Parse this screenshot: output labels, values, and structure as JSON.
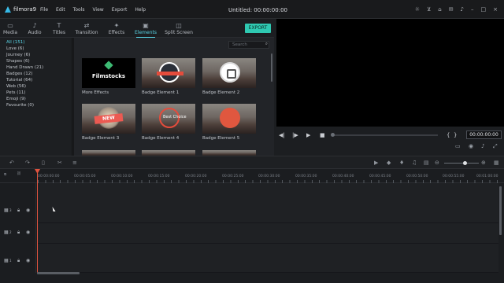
{
  "app": {
    "logo_text": "filmora9",
    "doc_title": "Untitled: 00:00:00:00"
  },
  "menu": [
    "File",
    "Edit",
    "Tools",
    "View",
    "Export",
    "Help"
  ],
  "tabs": [
    {
      "label": "Media",
      "icon": "folder-icon"
    },
    {
      "label": "Audio",
      "icon": "music-note-icon"
    },
    {
      "label": "Titles",
      "icon": "text-icon"
    },
    {
      "label": "Transition",
      "icon": "transition-icon"
    },
    {
      "label": "Effects",
      "icon": "effects-icon"
    },
    {
      "label": "Elements",
      "icon": "image-icon",
      "active": true
    },
    {
      "label": "Split Screen",
      "icon": "split-screen-icon"
    }
  ],
  "export_label": "EXPORT",
  "search": {
    "placeholder": "Search"
  },
  "categories": [
    "All (151)",
    "Love (6)",
    "Journey (6)",
    "Shapes (6)",
    "Hand Drawn (21)",
    "Badges (12)",
    "Tutorial (64)",
    "Web (56)",
    "Pets (11)",
    "Emoji (9)",
    "Favourite (0)"
  ],
  "items": [
    {
      "label": "More Effects",
      "brand": "Filmstocks"
    },
    {
      "label": "Badge Element 1"
    },
    {
      "label": "Badge Element 2"
    },
    {
      "label": "Badge Element 3",
      "badge_text": "NEW"
    },
    {
      "label": "Badge Element 4",
      "badge_text": "Best Choice"
    },
    {
      "label": "Badge Element 5"
    }
  ],
  "preview": {
    "timecode": "00:00:00:00",
    "progress": 0
  },
  "ruler": [
    "00:00:00:00",
    "00:00:05:00",
    "00:00:10:00",
    "00:00:15:00",
    "00:00:20:00",
    "00:00:25:00",
    "00:00:30:00",
    "00:00:35:00",
    "00:00:40:00",
    "00:00:45:00",
    "00:00:50:00",
    "00:00:55:00",
    "00:01:00:00"
  ],
  "track_numbers": [
    "3",
    "2",
    "1"
  ],
  "colors": {
    "accent": "#58d3e4",
    "export": "#2fc9b2",
    "playhead": "#e0533f"
  }
}
